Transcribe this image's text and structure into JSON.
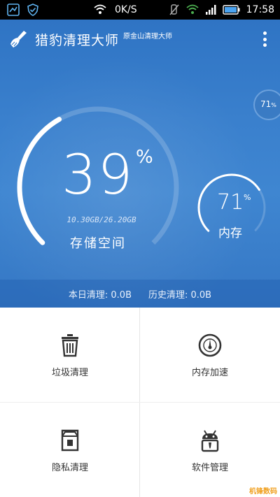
{
  "status_bar": {
    "speed": "0K/S",
    "time": "17:58",
    "icons": [
      "app-notify-icon",
      "shield-icon",
      "wifi-icon",
      "mute-icon",
      "wifi-icon",
      "signal-icon",
      "battery-icon"
    ]
  },
  "header": {
    "title": "猎豹清理大师",
    "subtitle": "原金山清理大师",
    "menu_icon": "more-vertical-icon"
  },
  "storage": {
    "percent": "39",
    "percent_sign": "%",
    "used_total": "10.30GB/26.20GB",
    "label": "存储空间",
    "fraction": 0.39
  },
  "memory": {
    "percent": "71",
    "percent_sign": "%",
    "label": "内存",
    "fraction": 0.71
  },
  "float_ball": {
    "percent": "71",
    "percent_sign": "%"
  },
  "stats": {
    "today": "本日清理: 0.0B",
    "history": "历史清理: 0.0B"
  },
  "features": [
    {
      "label": "垃圾清理",
      "icon": "trash-icon"
    },
    {
      "label": "内存加速",
      "icon": "speedometer-icon"
    },
    {
      "label": "隐私清理",
      "icon": "privacy-box-icon"
    },
    {
      "label": "软件管理",
      "icon": "android-icon"
    }
  ],
  "watermark": "机锋数码",
  "colors": {
    "hero_blue": "#3a80cd",
    "ring_white": "#ffffff",
    "icon_dark": "#333333"
  }
}
